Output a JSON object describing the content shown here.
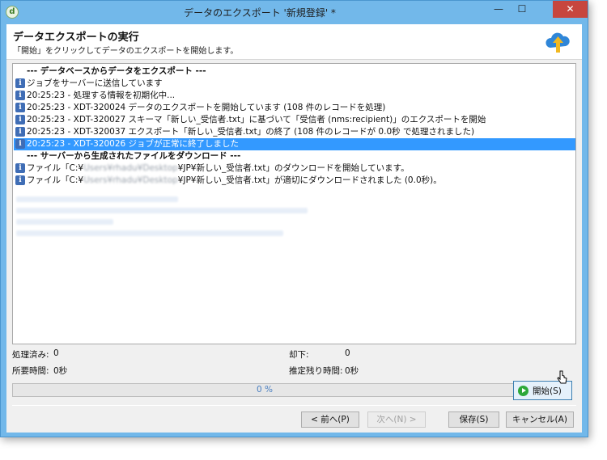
{
  "window": {
    "title": "データのエクスポート '新規登録' *",
    "minimize_glyph": "—",
    "maximize_glyph": "☐",
    "close_glyph": "✕"
  },
  "header": {
    "title": "データエクスポートの実行",
    "subtitle": "「開始」をクリックしてデータのエクスポートを開始します。"
  },
  "log": {
    "lines": [
      {
        "type": "separator",
        "text": "--- データベースからデータをエクスポート ---"
      },
      {
        "type": "info",
        "text": "ジョブをサーバーに送信しています"
      },
      {
        "type": "info",
        "text": "20:25:23 - 処理する情報を初期化中..."
      },
      {
        "type": "info",
        "text": "20:25:23 - XDT-320024 データのエクスポートを開始しています (108 件のレコードを処理)"
      },
      {
        "type": "info",
        "text": "20:25:23 - XDT-320027 スキーマ「新しい_受信者.txt」に基づいて「受信者 (nms:recipient)」のエクスポートを開始"
      },
      {
        "type": "info",
        "text": "20:25:23 - XDT-320037 エクスポート「新しい_受信者.txt」の終了 (108 件のレコードが 0.0秒 で処理されました)"
      },
      {
        "type": "info",
        "text": "20:25:23 - XDT-320026 ジョブが正常に終了しました",
        "selected": true
      },
      {
        "type": "separator",
        "text": "--- サーバーから生成されたファイルをダウンロード ---"
      },
      {
        "type": "file",
        "prefix": "ファイル「C:¥",
        "blurred": "Users¥rhadu¥Desktop",
        "suffix": "¥JP¥新しい_受信者.txt」のダウンロードを開始しています。"
      },
      {
        "type": "file",
        "prefix": "ファイル「C:¥",
        "blurred": "Users¥rhadu¥Desktop",
        "suffix": "¥JP¥新しい_受信者.txt」が適切にダウンロードされました (0.0秒)。"
      }
    ]
  },
  "stats": {
    "processed_label": "処理済み:",
    "processed_value": "0",
    "rejected_label": "却下:",
    "rejected_value": "0",
    "elapsed_label": "所要時間:",
    "elapsed_value": "0秒",
    "remaining_label": "推定残り時間:",
    "remaining_value": "0秒"
  },
  "progress": {
    "value_percent": 0,
    "label": "0 %"
  },
  "buttons": {
    "start": "開始(S)",
    "back": "< 前へ(P)",
    "next": "次へ(N) >",
    "save": "保存(S)",
    "cancel": "キャンセル(A)"
  },
  "icons": {
    "app": "app-icon",
    "cloud": "cloud-upload-icon",
    "info": "info-icon",
    "play": "play-icon"
  },
  "colors": {
    "selection": "#3399ff",
    "close_button": "#c7463e",
    "frame": "#72b8ea",
    "progress_text": "#4a7fc1",
    "cloud": "#2f86d8",
    "arrow": "#f1b820"
  }
}
